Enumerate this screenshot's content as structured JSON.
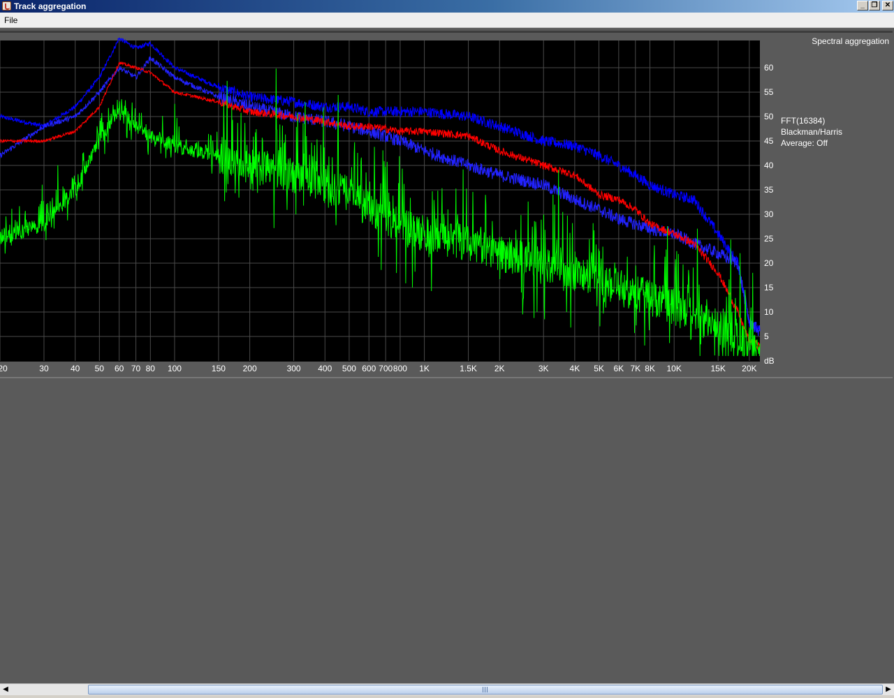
{
  "window": {
    "title": "Track aggregation"
  },
  "menubar": {
    "file_label": "File"
  },
  "panel": {
    "title": "Spectral aggregation",
    "info": {
      "fft": "FFT(16384)",
      "window": "Blackman/Harris",
      "average": "Average: Off"
    }
  },
  "chart_data": {
    "type": "line",
    "x_scale": "log",
    "xlim": [
      20,
      22050
    ],
    "ylim": [
      0,
      65
    ],
    "x_ticks": [
      {
        "v": 20,
        "label": "20"
      },
      {
        "v": 30,
        "label": "30"
      },
      {
        "v": 40,
        "label": "40"
      },
      {
        "v": 50,
        "label": "50"
      },
      {
        "v": 60,
        "label": "60"
      },
      {
        "v": 70,
        "label": "70"
      },
      {
        "v": 80,
        "label": "80"
      },
      {
        "v": 100,
        "label": "100"
      },
      {
        "v": 150,
        "label": "150"
      },
      {
        "v": 200,
        "label": "200"
      },
      {
        "v": 300,
        "label": "300"
      },
      {
        "v": 400,
        "label": "400"
      },
      {
        "v": 500,
        "label": "500"
      },
      {
        "v": 600,
        "label": "600"
      },
      {
        "v": 700,
        "label": "700"
      },
      {
        "v": 800,
        "label": "800"
      },
      {
        "v": 1000,
        "label": "1K"
      },
      {
        "v": 1500,
        "label": "1.5K"
      },
      {
        "v": 2000,
        "label": "2K"
      },
      {
        "v": 3000,
        "label": "3K"
      },
      {
        "v": 4000,
        "label": "4K"
      },
      {
        "v": 5000,
        "label": "5K"
      },
      {
        "v": 6000,
        "label": "6K"
      },
      {
        "v": 7000,
        "label": "7K"
      },
      {
        "v": 8000,
        "label": "8K"
      },
      {
        "v": 10000,
        "label": "10K"
      },
      {
        "v": 15000,
        "label": "15K"
      },
      {
        "v": 20000,
        "label": "20K"
      }
    ],
    "y_ticks": [
      60,
      55,
      50,
      45,
      40,
      35,
      30,
      25,
      20,
      15,
      10,
      5
    ],
    "y_unit": "dB",
    "grid": true,
    "series": [
      {
        "color": "#0000ff",
        "x": [
          20,
          30,
          40,
          50,
          60,
          70,
          80,
          100,
          150,
          200,
          300,
          400,
          500,
          600,
          800,
          1000,
          1500,
          2000,
          3000,
          4000,
          5000,
          6000,
          7000,
          8000,
          10000,
          12000,
          15000,
          18000,
          20000,
          22000
        ],
        "y": [
          50,
          48,
          52,
          58,
          66,
          64,
          65,
          60,
          56,
          54,
          53,
          52,
          52,
          51,
          51,
          51,
          50,
          48,
          45,
          44,
          42,
          40,
          38,
          36,
          34,
          33,
          26,
          20,
          8,
          6
        ],
        "noise": 2.2
      },
      {
        "color": "#2222ff",
        "x": [
          20,
          30,
          40,
          50,
          60,
          70,
          80,
          100,
          150,
          200,
          300,
          400,
          500,
          600,
          800,
          1000,
          1500,
          2000,
          3000,
          4000,
          5000,
          6000,
          7000,
          8000,
          10000,
          12000,
          15000,
          18000,
          20000,
          22000
        ],
        "y": [
          42,
          48,
          50,
          55,
          60,
          58,
          62,
          58,
          54,
          52,
          50,
          49,
          48,
          47,
          45,
          43,
          40,
          38,
          36,
          33,
          31,
          29,
          28,
          27,
          26,
          24,
          22,
          20,
          8,
          6
        ],
        "noise": 2.6
      },
      {
        "color": "#ff0000",
        "x": [
          20,
          30,
          40,
          50,
          60,
          70,
          80,
          100,
          150,
          200,
          300,
          400,
          500,
          600,
          800,
          1000,
          1500,
          2000,
          3000,
          4000,
          5000,
          6000,
          7000,
          8000,
          10000,
          12000,
          15000,
          18000,
          20000,
          22000
        ],
        "y": [
          45,
          45,
          47,
          52,
          61,
          60,
          59,
          55,
          53,
          51,
          50,
          49,
          48,
          48,
          47,
          47,
          46,
          43,
          40,
          38,
          34,
          33,
          31,
          28,
          26,
          24,
          18,
          10,
          4,
          3
        ],
        "noise": 1.6
      },
      {
        "color": "#00ff00",
        "x": [
          20,
          30,
          40,
          50,
          60,
          70,
          80,
          100,
          150,
          200,
          300,
          400,
          500,
          600,
          800,
          1000,
          1500,
          2000,
          3000,
          4000,
          5000,
          6000,
          7000,
          8000,
          10000,
          12000,
          15000,
          18000,
          20000,
          22000
        ],
        "y": [
          25,
          28,
          35,
          45,
          52,
          48,
          46,
          44,
          42,
          40,
          38,
          36,
          34,
          31,
          28,
          26,
          24,
          22,
          20,
          18,
          16,
          15,
          14,
          13,
          11,
          9,
          7,
          5,
          2,
          2
        ],
        "noise": 7.5
      }
    ]
  }
}
